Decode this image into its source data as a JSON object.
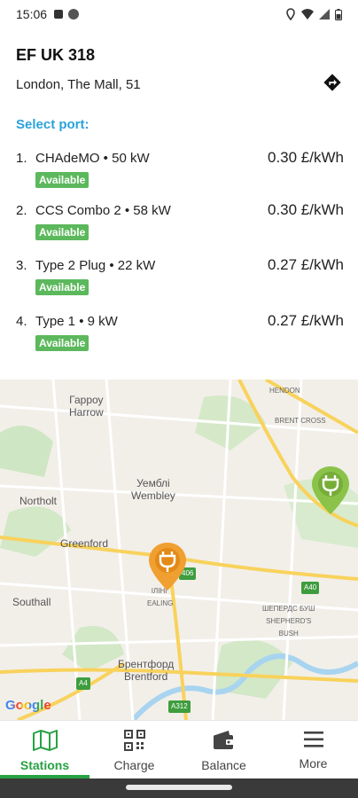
{
  "status_bar": {
    "time": "15:06"
  },
  "station": {
    "title": "EF UK 318",
    "address": "London, The Mall, 51",
    "select_port_label": "Select port:"
  },
  "ports": [
    {
      "num": "1.",
      "name": "CHAdeMO • 50 kW",
      "price": "0.30 £/kWh",
      "status": "Available"
    },
    {
      "num": "2.",
      "name": "CCS Combo 2 • 58 kW",
      "price": "0.30 £/kWh",
      "status": "Available"
    },
    {
      "num": "3.",
      "name": "Type 2 Plug • 22 kW",
      "price": "0.27 £/kWh",
      "status": "Available"
    },
    {
      "num": "4.",
      "name": "Type 1 • 9 kW",
      "price": "0.27 £/kWh",
      "status": "Available"
    }
  ],
  "map": {
    "labels": {
      "harrow": "Гарроу\nHarrow",
      "wembley": "Уемблі\nWembley",
      "northolt": "Northolt",
      "greenford": "Greenford",
      "southall": "Southall",
      "brentford": "Брентфорд\nBrentford",
      "hendon": "HENDON",
      "brent_cross": "BRENT CROSS",
      "shepherds_bush": "ШЕПЕРДС БУШ\nSHEPHERD'S\nBUSH",
      "ealing": "ІЛІНГ\nEALING",
      "a40": "A40",
      "a4": "A4",
      "a312": "A312",
      "a406": "406"
    },
    "google": "Google"
  },
  "nav": {
    "stations": "Stations",
    "charge": "Charge",
    "balance": "Balance",
    "more": "More"
  },
  "colors": {
    "accent": "#29a3db",
    "available": "#5cb85c",
    "active_nav": "#27a243",
    "selected_pin": "#f0a030",
    "other_pin": "#8bc34a"
  }
}
